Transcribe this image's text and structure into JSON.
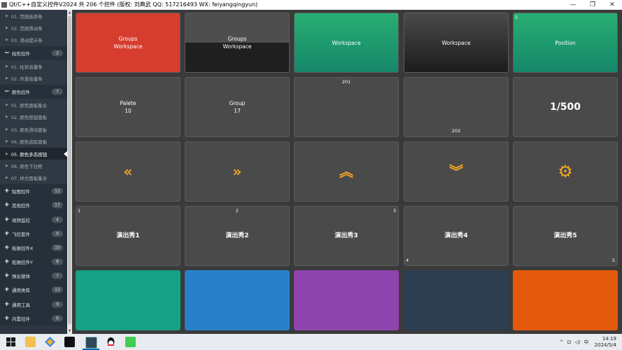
{
  "window": {
    "title": "Qt/C++自定义控件V2024 共 206 个控件 (版权: 刘典武 QQ: 517216493 WX: feiyangqingyun)",
    "controls": [
      "—",
      "❐",
      "✕"
    ]
  },
  "sidebar": {
    "items": [
      {
        "type": "child",
        "label": "01. 范围选择条"
      },
      {
        "type": "child",
        "label": "02. 范围滑动条"
      },
      {
        "type": "child",
        "label": "03. 滑动提示条"
      },
      {
        "type": "parent",
        "label": "柱形控件",
        "count": "2",
        "expanded": true
      },
      {
        "type": "child",
        "label": "01. 柱状音量条"
      },
      {
        "type": "child",
        "label": "02. 声道音量条"
      },
      {
        "type": "parent",
        "label": "颜色控件",
        "count": "7",
        "expanded": true
      },
      {
        "type": "child",
        "label": "01. 颜色面板集合"
      },
      {
        "type": "child",
        "label": "02. 颜色按钮面板"
      },
      {
        "type": "child",
        "label": "03. 颜色滑块面板"
      },
      {
        "type": "child",
        "label": "04. 颜色选取面板"
      },
      {
        "type": "child",
        "label": "05. 颜色多态按钮",
        "active": true
      },
      {
        "type": "child",
        "label": "06. 颜色下拉框"
      },
      {
        "type": "child",
        "label": "07. 样式面板集合"
      },
      {
        "type": "parent",
        "label": "贴图控件",
        "count": "12",
        "expanded": false
      },
      {
        "type": "parent",
        "label": "其他控件",
        "count": "17",
        "expanded": false
      },
      {
        "type": "parent",
        "label": "视频监控",
        "count": "4",
        "expanded": false
      },
      {
        "type": "parent",
        "label": "飞控套件",
        "count": "9",
        "expanded": false
      },
      {
        "type": "parent",
        "label": "拓展控件X",
        "count": "10",
        "expanded": false
      },
      {
        "type": "parent",
        "label": "拓展控件Y",
        "count": "8",
        "expanded": false
      },
      {
        "type": "parent",
        "label": "弹出窗体",
        "count": "7",
        "expanded": false
      },
      {
        "type": "parent",
        "label": "通用类库",
        "count": "12",
        "expanded": false
      },
      {
        "type": "parent",
        "label": "通用工具",
        "count": "9",
        "expanded": false
      },
      {
        "type": "parent",
        "label": "内置控件",
        "count": "6",
        "expanded": false
      }
    ]
  },
  "tiles": {
    "r1": [
      {
        "line1": "Groups",
        "line2": "Workspace",
        "bg": "#d63d2e"
      },
      {
        "line1": "Groups",
        "line2": "Workspace",
        "bg_top": "#4e4e4e",
        "bg_bottom": "#1f1f1f"
      },
      {
        "text": "Workspace",
        "bg_top": "#27ae72",
        "bg_bottom": "#16876a"
      },
      {
        "text": "Workspace",
        "bg_top": "#4a4a4a",
        "bg_bottom": "#1c1c1c"
      },
      {
        "text": "Position",
        "corner": "5",
        "bg_top": "#27ae72",
        "bg_bottom": "#16876a"
      }
    ],
    "r2": [
      {
        "line1": "Palete",
        "line2": "10"
      },
      {
        "line1": "Group",
        "line2": "17"
      },
      {
        "top_label": "201"
      },
      {
        "bottom_label": "202"
      },
      {
        "big": "1/500"
      }
    ],
    "r3_icons": [
      "double-chevron-left-icon",
      "double-chevron-right-icon",
      "double-chevron-up-icon",
      "double-chevron-down-icon",
      "gears-icon"
    ],
    "r3_glyphs": [
      "«",
      "»",
      "︽",
      "︾",
      "⚙"
    ],
    "r4": [
      {
        "text": "演出秀1",
        "corner": "1"
      },
      {
        "text": "演出秀2",
        "corner": "2"
      },
      {
        "text": "演出秀3",
        "corner": "3"
      },
      {
        "text": "演出秀4",
        "corner": "4"
      },
      {
        "text": "演出秀5",
        "corner": "5"
      }
    ],
    "r5_colors": [
      "#16a085",
      "#2980c9",
      "#8e44ad",
      "#2c3e50",
      "#e35a0c"
    ]
  },
  "taskbar": {
    "tray": [
      "^",
      "⊡",
      "◁)",
      "中"
    ],
    "time": "14:19",
    "date": "2024/5/4"
  }
}
